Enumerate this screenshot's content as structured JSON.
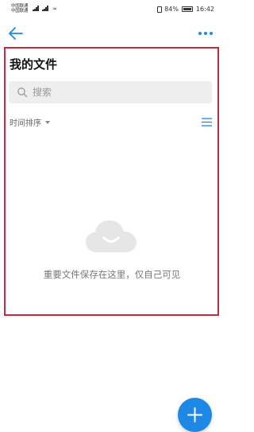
{
  "status_bar": {
    "carrier_1": "中国联通",
    "carrier_2": "中国联通",
    "battery": "84%",
    "time": "16:42"
  },
  "header": {
    "back_icon": "arrow-left",
    "more_icon": "ellipsis-horizontal"
  },
  "page": {
    "title": "我的文件"
  },
  "search": {
    "placeholder": "搜索"
  },
  "toolbar": {
    "sort_label": "时间排序",
    "view_icon": "list"
  },
  "empty_state": {
    "icon": "cloud-smile",
    "message": "重要文件保存在这里，仅自己可见"
  },
  "fab": {
    "icon": "plus"
  },
  "colors": {
    "accent": "#1e88e5",
    "highlight_border": "#c8283a"
  }
}
